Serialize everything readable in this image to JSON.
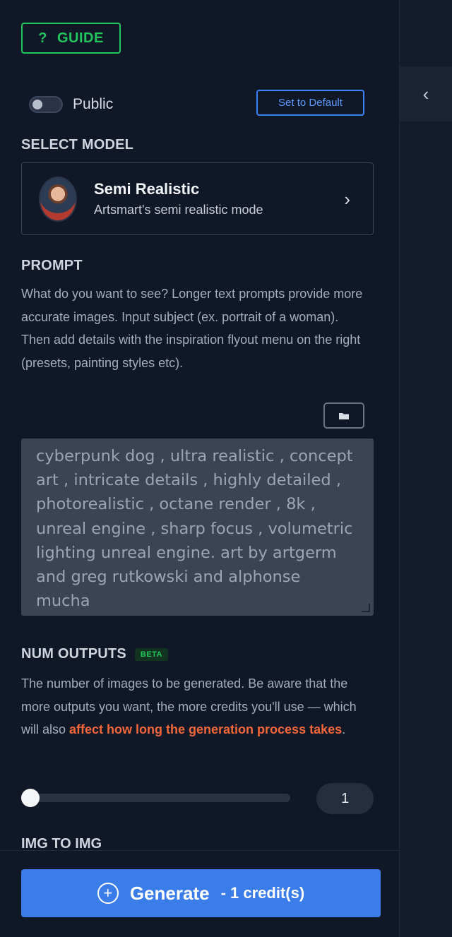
{
  "guide": {
    "icon": "?",
    "label": "GUIDE"
  },
  "public_toggle": {
    "label": "Public",
    "state": "off"
  },
  "set_default": {
    "label": "Set to Default"
  },
  "select_model": {
    "title": "SELECT MODEL",
    "name": "Semi Realistic",
    "description": "Artsmart's semi realistic mode"
  },
  "prompt": {
    "title": "PROMPT",
    "help": "What do you want to see? Longer text prompts provide more accurate images. Input subject (ex. portrait of a woman). Then add details with the inspiration flyout menu on the right (presets, painting styles etc).",
    "placeholder": "cyberpunk dog , ultra realistic , concept art , intricate details , highly detailed , photorealistic , octane render , 8k , unreal engine , sharp focus , volumetric lighting unreal engine. art by artgerm and greg rutkowski and alphonse mucha"
  },
  "num_outputs": {
    "title": "NUM OUTPUTS",
    "badge": "BETA",
    "help_prefix": "The number of images to be generated. Be aware that the more outputs you want, the more credits you'll use — which will also ",
    "help_warning": "affect how long the generation process takes",
    "help_suffix": ".",
    "value": "1"
  },
  "img_to_img": {
    "title": "IMG TO IMG"
  },
  "generate": {
    "label": "Generate",
    "cost": "- 1 credit(s)"
  },
  "colors": {
    "accent_blue": "#3b7de8",
    "guide_green": "#22c55e",
    "warning_orange": "#f2683a"
  }
}
